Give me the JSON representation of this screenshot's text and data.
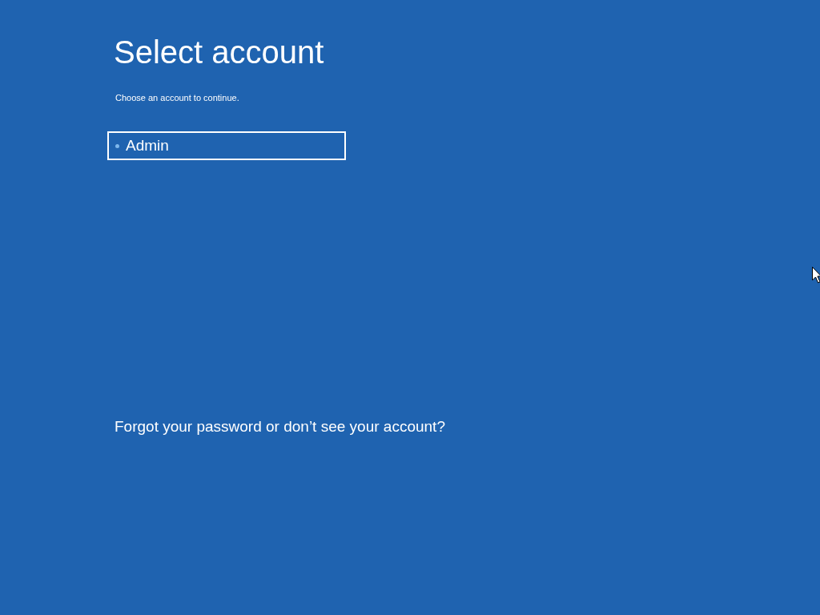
{
  "title": "Select account",
  "subtitle": "Choose an account to continue.",
  "accounts": [
    {
      "name": "Admin",
      "selected": true
    }
  ],
  "help_link": "Forgot your password or don’t see your account?"
}
